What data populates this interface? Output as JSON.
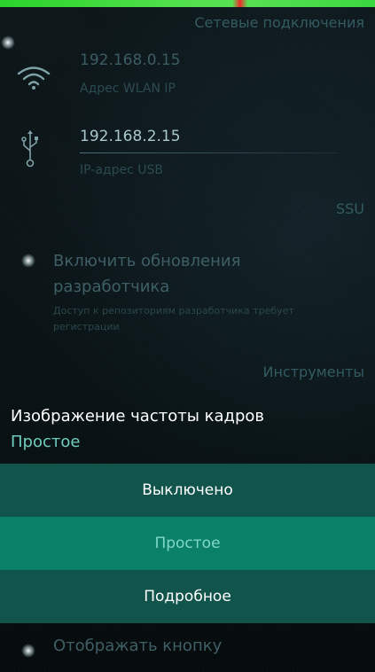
{
  "network": {
    "header": "Сетевые подключения",
    "wlan": {
      "icon": "wifi-icon",
      "value": "192.168.0.15",
      "label": "Адрес WLAN IP"
    },
    "usb": {
      "icon": "usb-icon",
      "value": "192.168.2.15",
      "label": "IP-адрес USB"
    }
  },
  "ssu": {
    "header": "SSU",
    "dev_updates": {
      "title": "Включить обновления разработчика",
      "description": "Доступ к репозиториям разработчика требует регистрации"
    }
  },
  "tools": {
    "header": "Инструменты",
    "fps_display": {
      "label": "Изображение частоты кадров",
      "value": "Простое",
      "options": [
        "Выключено",
        "Простое",
        "Подробное"
      ],
      "selected_index": 1
    },
    "next_item": {
      "title": "Отображать кнопку"
    }
  },
  "colors": {
    "accent": "#6fcdbd",
    "highlight": "#0b8069",
    "menu_background": "#11544b",
    "status_bar": "#4fe04a",
    "status_bar_marker": "#ef2a2a"
  }
}
